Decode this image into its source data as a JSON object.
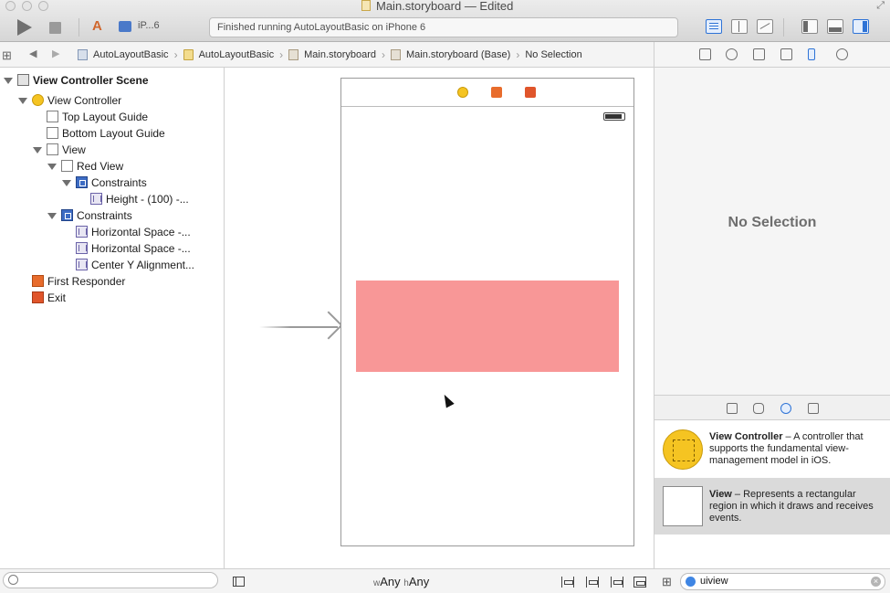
{
  "window": {
    "title": "Main.storyboard — Edited"
  },
  "toolbar": {
    "scheme_device": "iP...6",
    "activity_status": "Finished running AutoLayoutBasic on iPhone 6"
  },
  "jumpbar": {
    "breadcrumb": [
      "AutoLayoutBasic",
      "AutoLayoutBasic",
      "Main.storyboard",
      "Main.storyboard (Base)",
      "No Selection"
    ]
  },
  "outline": {
    "items": [
      {
        "label": "View Controller Scene",
        "bold": true,
        "icon": "scene-icon"
      },
      {
        "label": "View Controller",
        "icon": "view-controller-icon"
      },
      {
        "label": "Top Layout Guide",
        "icon": "layout-guide-icon"
      },
      {
        "label": "Bottom Layout Guide",
        "icon": "layout-guide-icon"
      },
      {
        "label": "View",
        "icon": "view-icon"
      },
      {
        "label": "Red View",
        "icon": "view-icon"
      },
      {
        "label": "Constraints",
        "icon": "constraints-icon"
      },
      {
        "label": "Height - (100) -...",
        "icon": "constraint-icon"
      },
      {
        "label": "Constraints",
        "icon": "constraints-icon"
      },
      {
        "label": "Horizontal Space -...",
        "icon": "constraint-icon"
      },
      {
        "label": "Horizontal Space -...",
        "icon": "constraint-icon"
      },
      {
        "label": "Center Y Alignment...",
        "icon": "constraint-icon"
      },
      {
        "label": "First Responder",
        "icon": "first-responder-icon"
      },
      {
        "label": "Exit",
        "icon": "exit-icon"
      }
    ]
  },
  "canvas": {
    "red_view_color": "#f89797"
  },
  "bottombar": {
    "size_class_w_prefix": "w",
    "size_class_w": "Any",
    "size_class_h_prefix": "h",
    "size_class_h": "Any"
  },
  "inspector": {
    "empty_label": "No Selection"
  },
  "library": {
    "filter_value": "uiview",
    "items": [
      {
        "title": "View Controller",
        "desc": " – A controller that supports the fundamental view-management model in iOS."
      },
      {
        "title": "View",
        "desc": " – Represents a rectangular region in which it draws and receives events."
      }
    ]
  }
}
